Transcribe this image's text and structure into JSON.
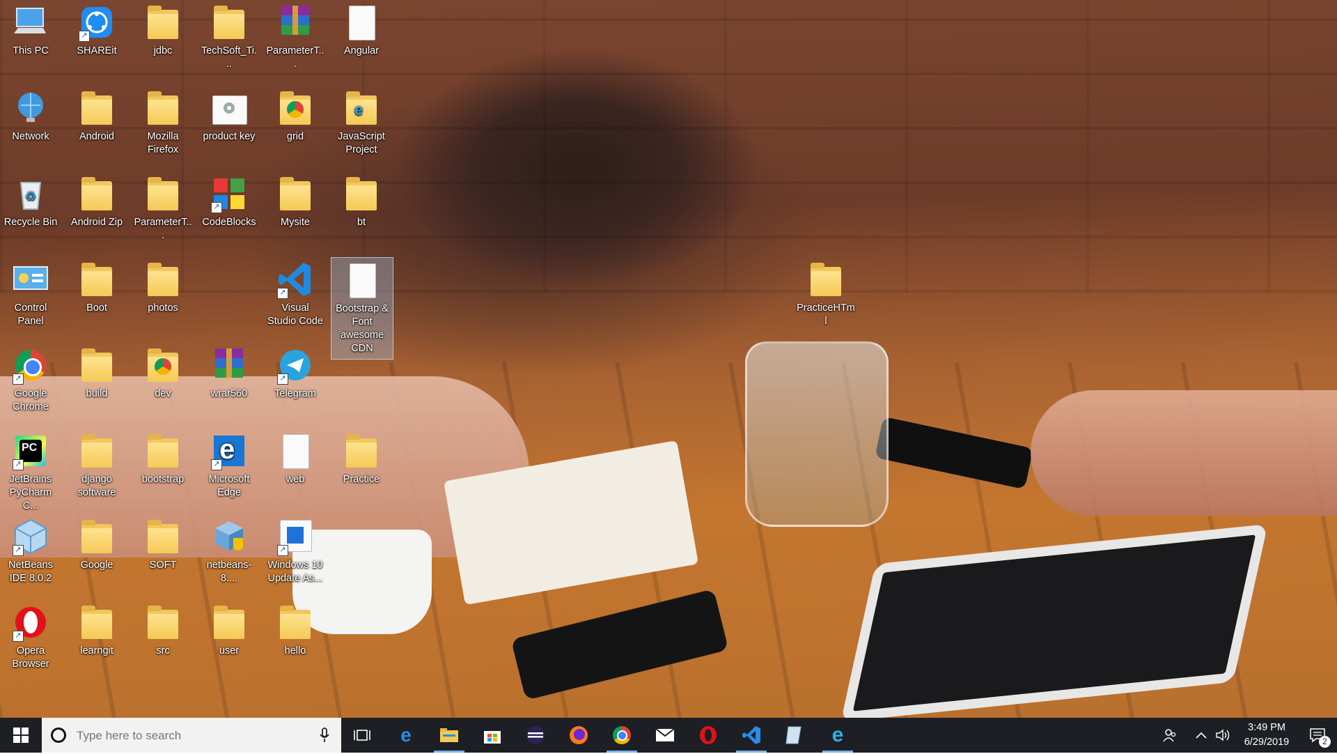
{
  "desktop": {
    "icons": [
      {
        "label": "This PC",
        "icon": "this-pc-icon",
        "kind": "pc"
      },
      {
        "label": "SHAREit",
        "icon": "shareit-icon",
        "kind": "shareit",
        "shortcut": true
      },
      {
        "label": "jdbc",
        "icon": "folder-icon",
        "kind": "folder"
      },
      {
        "label": "TechSoft_Ti...",
        "icon": "folder-icon",
        "kind": "folder"
      },
      {
        "label": "ParameterT...",
        "icon": "winrar-icon",
        "kind": "winrar"
      },
      {
        "label": "Angular",
        "icon": "file-icon",
        "kind": "doc"
      },
      {
        "label": "Network",
        "icon": "network-icon",
        "kind": "network"
      },
      {
        "label": "Android",
        "icon": "folder-icon",
        "kind": "folder"
      },
      {
        "label": "Mozilla Firefox",
        "icon": "folder-icon",
        "kind": "folder"
      },
      {
        "label": "product key",
        "icon": "settings-file-icon",
        "kind": "settings"
      },
      {
        "label": "grid",
        "icon": "chrome-folder-icon",
        "kind": "chromefolder"
      },
      {
        "label": "JavaScript Project",
        "icon": "ie-folder-icon",
        "kind": "iefolder"
      },
      {
        "label": "Recycle Bin",
        "icon": "recycle-bin-icon",
        "kind": "recycle"
      },
      {
        "label": "Android Zip",
        "icon": "folder-icon",
        "kind": "folder"
      },
      {
        "label": "ParameterT...",
        "icon": "folder-icon",
        "kind": "folder"
      },
      {
        "label": "CodeBlocks",
        "icon": "codeblocks-icon",
        "kind": "codeblocks",
        "shortcut": true
      },
      {
        "label": "Mysite",
        "icon": "folder-icon",
        "kind": "folder"
      },
      {
        "label": "bt",
        "icon": "folder-icon",
        "kind": "folder"
      },
      {
        "label": "Control Panel",
        "icon": "control-panel-icon",
        "kind": "control"
      },
      {
        "label": "Boot",
        "icon": "folder-icon",
        "kind": "folder"
      },
      {
        "label": "photos",
        "icon": "folder-icon",
        "kind": "folder"
      },
      {
        "label": "Visual Studio Code",
        "icon": "vscode-icon",
        "kind": "vscode",
        "shortcut": true
      },
      {
        "label": "Bootstrap & Font awesome CDN",
        "icon": "file-icon",
        "kind": "doc",
        "selected": true
      },
      {
        "label": "PracticeHTml",
        "icon": "folder-icon",
        "kind": "folder"
      },
      {
        "label": "Google Chrome",
        "icon": "chrome-icon",
        "kind": "chrome",
        "shortcut": true
      },
      {
        "label": "build",
        "icon": "folder-icon",
        "kind": "folder"
      },
      {
        "label": "dev",
        "icon": "chrome-folder-icon",
        "kind": "chromefolder"
      },
      {
        "label": "wrar560",
        "icon": "winrar-installer-icon",
        "kind": "winrar"
      },
      {
        "label": "Telegram",
        "icon": "telegram-icon",
        "kind": "telegram",
        "shortcut": true
      },
      {
        "label": "JetBrains PyCharm C...",
        "icon": "pycharm-icon",
        "kind": "pycharm",
        "shortcut": true
      },
      {
        "label": "django software",
        "icon": "folder-icon",
        "kind": "folder"
      },
      {
        "label": "bootstrap",
        "icon": "folder-icon",
        "kind": "folder"
      },
      {
        "label": "Microsoft Edge",
        "icon": "edge-icon",
        "kind": "edge",
        "shortcut": true
      },
      {
        "label": "web",
        "icon": "web-file-icon",
        "kind": "doc"
      },
      {
        "label": "Practice",
        "icon": "folder-icon",
        "kind": "folder"
      },
      {
        "label": "NetBeans IDE 8.0.2",
        "icon": "netbeans-icon",
        "kind": "netbeans",
        "shortcut": true
      },
      {
        "label": "Google",
        "icon": "folder-icon",
        "kind": "folder"
      },
      {
        "label": "SOFT",
        "icon": "folder-icon",
        "kind": "folder"
      },
      {
        "label": "netbeans-8....",
        "icon": "netbeans-installer-icon",
        "kind": "installer"
      },
      {
        "label": "Windows 10 Update As...",
        "icon": "windows-update-icon",
        "kind": "winupdate",
        "shortcut": true
      },
      {
        "label": "Opera Browser",
        "icon": "opera-icon",
        "kind": "opera",
        "shortcut": true
      },
      {
        "label": "learngit",
        "icon": "folder-icon",
        "kind": "folder"
      },
      {
        "label": "src",
        "icon": "folder-icon",
        "kind": "folder"
      },
      {
        "label": "user",
        "icon": "folder-icon",
        "kind": "folder"
      },
      {
        "label": "hello",
        "icon": "folder-icon",
        "kind": "folder"
      }
    ]
  },
  "taskbar": {
    "search_placeholder": "Type here to search",
    "apps": [
      {
        "name": "edge",
        "icon": "edge-icon",
        "active": false
      },
      {
        "name": "file-explorer",
        "icon": "file-explorer-icon",
        "active": true
      },
      {
        "name": "store",
        "icon": "store-icon",
        "active": false
      },
      {
        "name": "eclipse",
        "icon": "eclipse-icon",
        "active": false
      },
      {
        "name": "firefox",
        "icon": "firefox-icon",
        "active": false
      },
      {
        "name": "chrome",
        "icon": "chrome-icon",
        "active": true
      },
      {
        "name": "mail",
        "icon": "mail-icon",
        "active": false
      },
      {
        "name": "opera",
        "icon": "opera-icon",
        "active": false
      },
      {
        "name": "vscode",
        "icon": "vscode-icon",
        "active": true
      },
      {
        "name": "notepad-app",
        "icon": "notepad-icon",
        "active": false
      },
      {
        "name": "internet-explorer",
        "icon": "ie-icon",
        "active": true
      }
    ],
    "time": "3:49 PM",
    "date": "6/29/2019",
    "notification_count": "2"
  },
  "colors": {
    "taskbar_bg": "#1d1f24",
    "accent": "#7fb2e5",
    "folder": "#f5c955"
  }
}
